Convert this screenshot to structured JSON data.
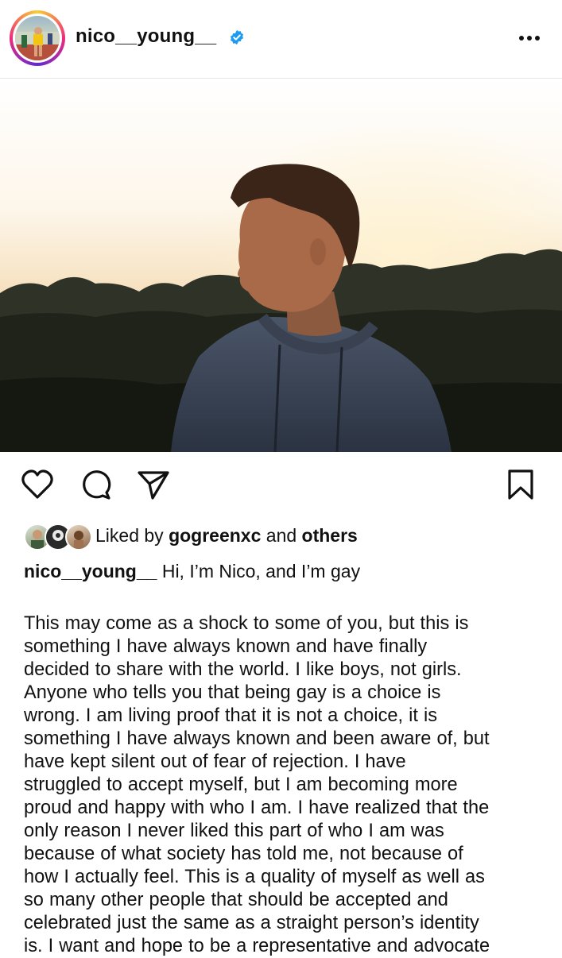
{
  "post": {
    "username": "nico__young__",
    "liked_prefix": "Liked by ",
    "liked_by_user": "gogreenxc",
    "liked_and": " and ",
    "liked_others": "others",
    "caption_username": "nico__young__",
    "caption_headline": " Hi, I’m Nico, and I’m gay",
    "caption_body": "This may come as a shock to some of you, but this is\nsomething I have always known and have finally\ndecided to share with the world. I like boys, not girls.\nAnyone who tells you that being gay is a choice is\nwrong. I am living proof that it is not a choice, it is\nsomething I have always known and been aware of, but\nhave kept silent out of fear of rejection. I have\nstruggled to accept myself, but I am becoming more\nproud and happy with who I am. I have realized that the\nonly reason I never liked this part of who I am was\nbecause of what society has told me, not because of\nhow I actually feel. This is a quality of myself as well as\nso many other people that should be accepted and\ncelebrated just the same as a straight person’s identity\nis. I want and hope to be a representative and advocate"
  },
  "icons": {
    "verified": "verified-badge-icon",
    "more": "more-options-icon",
    "like": "heart-icon",
    "comment": "comment-icon",
    "share": "send-icon",
    "save": "bookmark-icon"
  },
  "colors": {
    "verified_blue": "#1d9bf0",
    "text": "#111111",
    "divider": "#e6e6e6"
  }
}
